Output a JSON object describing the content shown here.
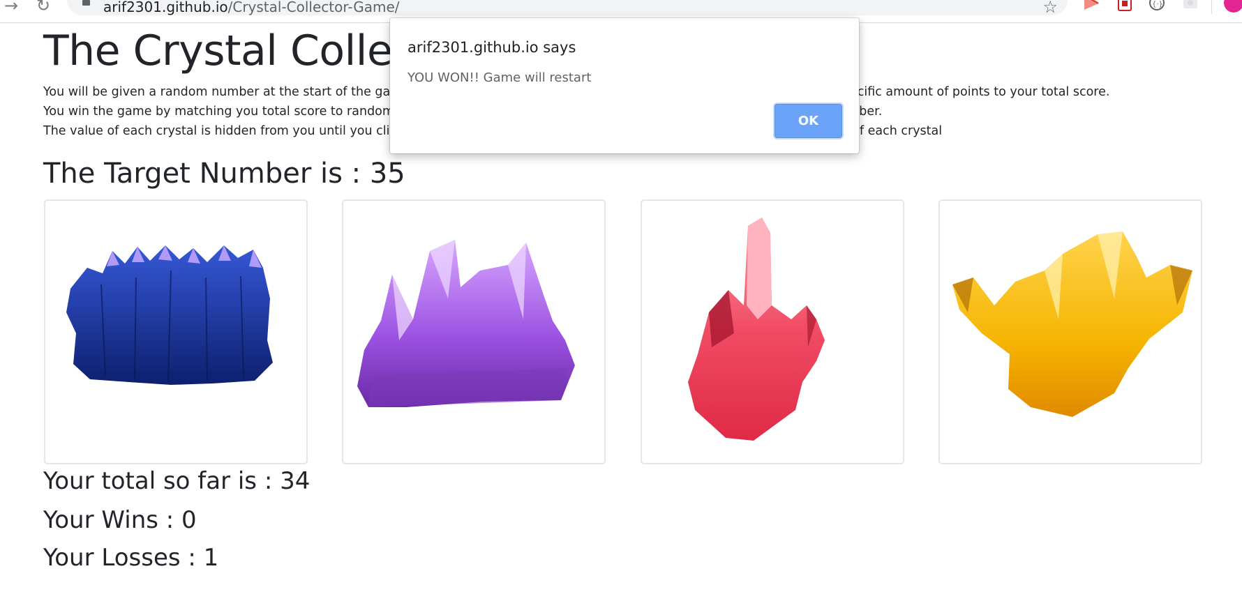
{
  "browser": {
    "url_domain": "arif2301.github.io",
    "url_path": "/Crystal-Collector-Game/"
  },
  "page": {
    "title": "The Crystal Collector",
    "instructions": [
      "You will be given a random number at the start of the game. There are four crystals below. By clicking on a crystal you will add a specific amount of points to your total score.",
      "You win the game by matching you total score to random number, you lose the game if your total score goes above the random number.",
      "The value of each crystal is hidden from you until you click on it. Each time when the game starts, the game will change the values of each crystal"
    ],
    "target_label": "The Target Number is : 35",
    "total_label": "Your total so far is : 34",
    "wins_label": "Your Wins : 0",
    "losses_label": "Your Losses : 1"
  },
  "crystals": [
    {
      "name": "blue-crystal",
      "color": "#1d3aa8"
    },
    {
      "name": "purple-crystal",
      "color": "#9b4fe0"
    },
    {
      "name": "red-crystal",
      "color": "#ef4a62"
    },
    {
      "name": "yellow-crystal",
      "color": "#f5b400"
    }
  ],
  "alert": {
    "title": "arif2301.github.io says",
    "message": "YOU WON!! Game will restart",
    "ok_label": "OK"
  },
  "colors": {
    "alert_button": "#6aa3f7",
    "text": "#212529"
  }
}
